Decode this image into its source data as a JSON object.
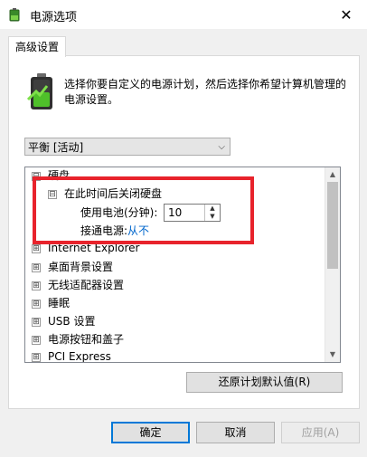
{
  "window": {
    "title": "电源选项",
    "close_label": "✕"
  },
  "tab": {
    "label": "高级设置"
  },
  "description": "选择你要自定义的电源计划，然后选择你希望计算机管理的电源设置。",
  "plan_select": {
    "value": "平衡 [活动]"
  },
  "tree": {
    "items": [
      {
        "label": "硬盘",
        "expander": "⊟"
      },
      {
        "label": "在此时间后关闭硬盘",
        "expander": "⊟"
      },
      {
        "label": "使用电池(分钟):"
      },
      {
        "label": "接通电源:"
      },
      {
        "label": "从不"
      },
      {
        "label": "Internet Explorer",
        "expander": "⊞"
      },
      {
        "label": "桌面背景设置",
        "expander": "⊞"
      },
      {
        "label": "无线适配器设置",
        "expander": "⊞"
      },
      {
        "label": "睡眠",
        "expander": "⊞"
      },
      {
        "label": "USB 设置",
        "expander": "⊞"
      },
      {
        "label": "电源按钮和盖子",
        "expander": "⊞"
      },
      {
        "label": "PCI Express",
        "expander": "⊞"
      }
    ],
    "battery_minutes": "10"
  },
  "buttons": {
    "restore": "还原计划默认值(R)",
    "ok": "确定",
    "cancel": "取消",
    "apply": "应用(A)"
  },
  "colors": {
    "highlight_border": "#e8232c",
    "link": "#0066cc",
    "accent": "#0078d7"
  }
}
